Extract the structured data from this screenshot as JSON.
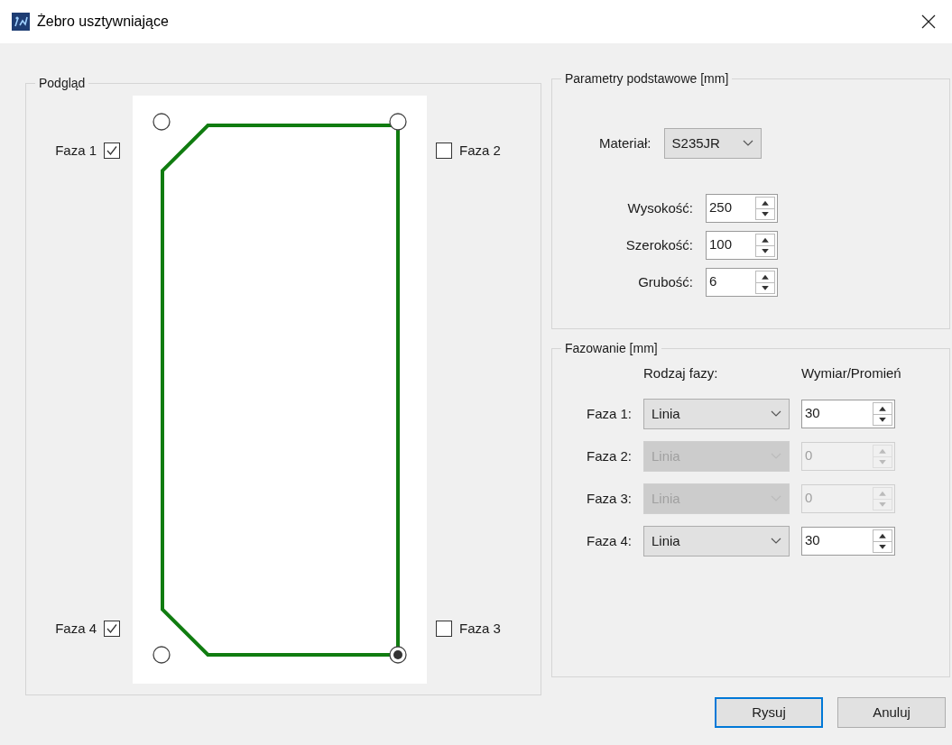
{
  "window": {
    "title": "Żebro usztywniające"
  },
  "preview": {
    "title": "Podgląd",
    "corner_radios": [
      {
        "selected": false
      },
      {
        "selected": false
      },
      {
        "selected": false
      },
      {
        "selected": true
      }
    ],
    "chamfer_checkboxes": [
      {
        "label": "Faza 1",
        "checked": true
      },
      {
        "label": "Faza 2",
        "checked": false
      },
      {
        "label": "Faza 4",
        "checked": true
      },
      {
        "label": "Faza 3",
        "checked": false
      }
    ]
  },
  "basic_params": {
    "title": "Parametry podstawowe [mm]",
    "material": {
      "label": "Materiał:",
      "value": "S235JR"
    },
    "fields": [
      {
        "label": "Wysokość:",
        "value": "250"
      },
      {
        "label": "Szerokość:",
        "value": "100"
      },
      {
        "label": "Grubość:",
        "value": "6"
      }
    ]
  },
  "chamfering": {
    "title": "Fazowanie [mm]",
    "columns": [
      "Rodzaj fazy:",
      "Wymiar/Promień"
    ],
    "rows": [
      {
        "label": "Faza 1:",
        "type": "Linia",
        "value": "30",
        "disabled": false
      },
      {
        "label": "Faza 2:",
        "type": "Linia",
        "value": "0",
        "disabled": true
      },
      {
        "label": "Faza 3:",
        "type": "Linia",
        "value": "0",
        "disabled": true
      },
      {
        "label": "Faza 4:",
        "type": "Linia",
        "value": "30",
        "disabled": false
      }
    ]
  },
  "buttons": [
    {
      "label": "Rysuj",
      "default": true
    },
    {
      "label": "Anuluj",
      "default": false
    }
  ]
}
